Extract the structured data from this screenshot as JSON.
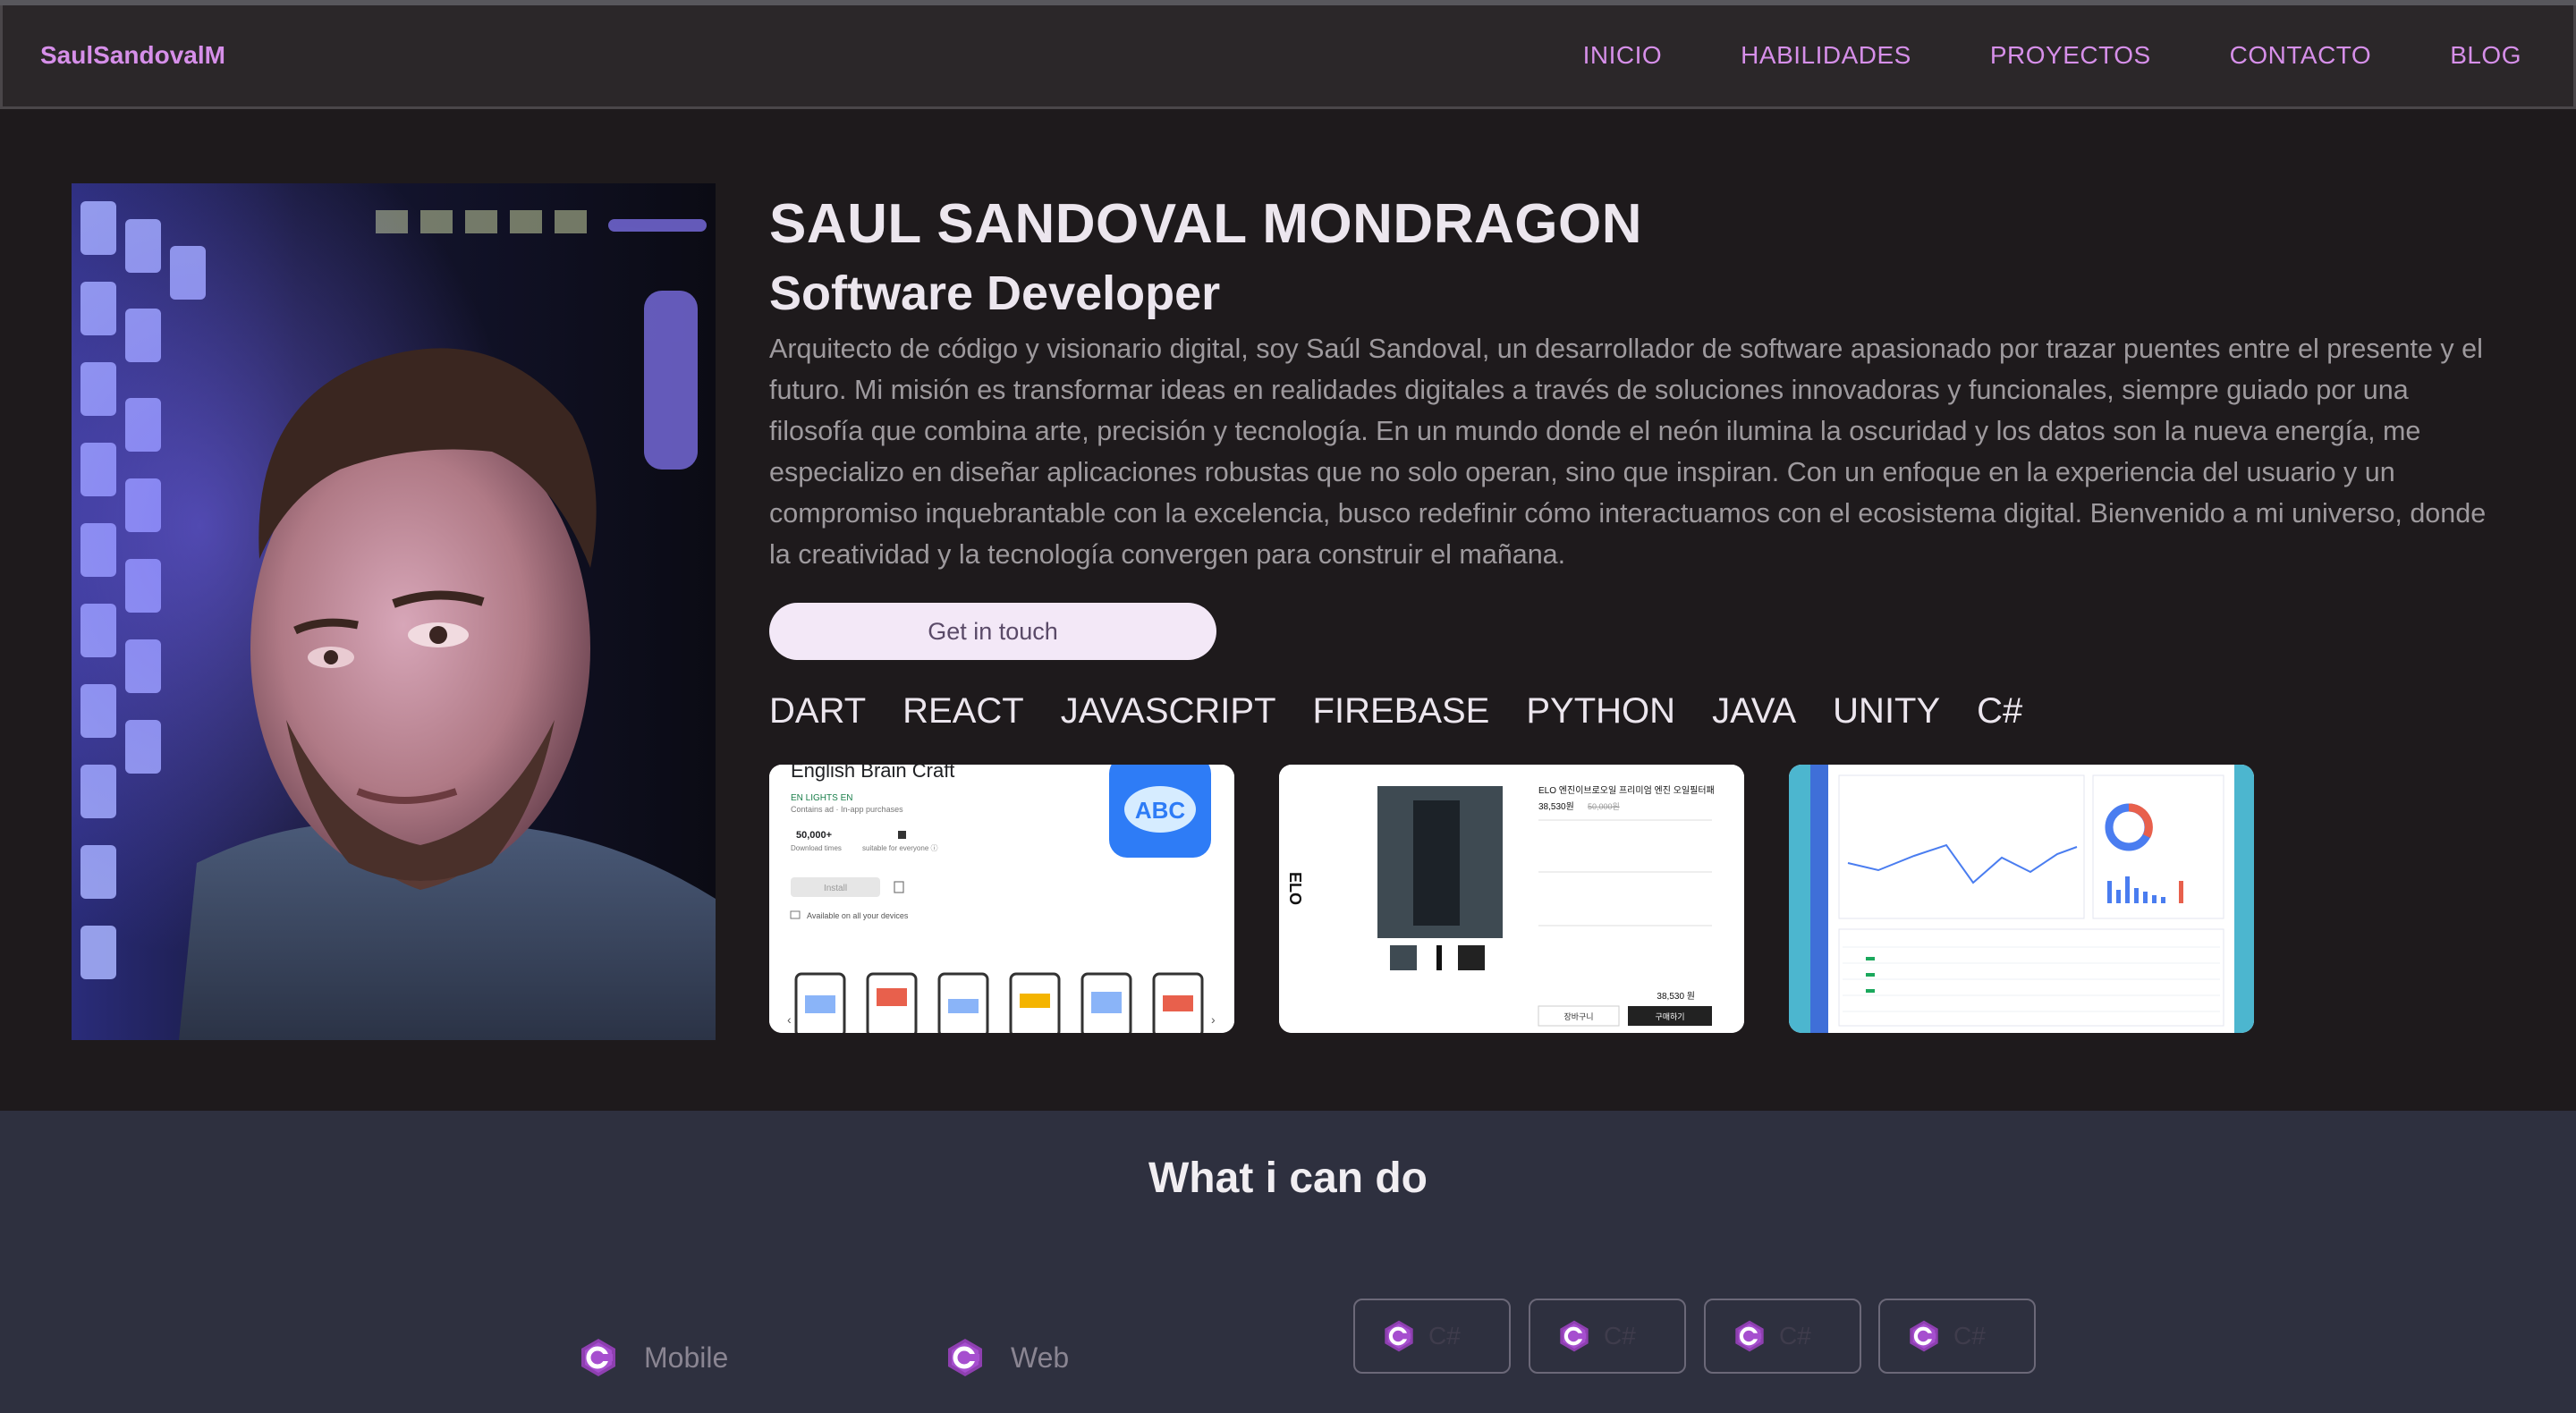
{
  "nav": {
    "brand": "SaulSandovalM",
    "links": [
      "INICIO",
      "HABILIDADES",
      "PROYECTOS",
      "CONTACTO",
      "BLOG"
    ]
  },
  "hero": {
    "name": "SAUL SANDOVAL MONDRAGON",
    "role": "Software Developer",
    "bio": "Arquitecto de código y visionario digital, soy Saúl Sandoval, un desarrollador de software apasionado por trazar puentes entre el presente y el futuro. Mi misión es transformar ideas en realidades digitales a través de soluciones innovadoras y funcionales, siempre guiado por una filosofía que combina arte, precisión y tecnología. En un mundo donde el neón ilumina la oscuridad y los datos son la nueva energía, me especializo en diseñar aplicaciones robustas que no solo operan, sino que inspiran. Con un enfoque en la experiencia del usuario y un compromiso inquebrantable con la excelencia, busco redefinir cómo interactuamos con el ecosistema digital. Bienvenido a mi universo, donde la creatividad y la tecnología convergen para construir el mañana.",
    "cta_label": "Get in touch",
    "skills": [
      "DART",
      "REACT",
      "JAVASCRIPT",
      "FIREBASE",
      "PYTHON",
      "JAVA",
      "UNITY",
      "C#"
    ]
  },
  "projects": [
    {
      "title": "English Brain Craft",
      "publisher": "EN LIGHTS EN",
      "note": "Contains ad · In-app purchases",
      "downloads": "50,000+",
      "downloads_label": "Download times",
      "rating_label": "suitable for everyone ⓘ",
      "install_label": "Install",
      "devices_label": "Available on all your devices",
      "logo_text": "ABC"
    },
    {
      "brand": "ELO",
      "product_title": "ELO 엔진이브로오일 프리미엄 엔진 오일필터패",
      "price": "38,530원",
      "old_price": "50,000원",
      "total": "38,530 원",
      "btn_left": "장바구니",
      "btn_right": "구매하기"
    },
    {
      "kind": "dashboard"
    }
  ],
  "what": {
    "title": "What i can do",
    "categories": [
      "Mobile",
      "Web"
    ],
    "chips": [
      "C#",
      "C#",
      "C#",
      "C#"
    ]
  },
  "colors": {
    "accent": "#d68fe9",
    "nav_bg": "#2b2729",
    "hero_bg": "#1e1a1c",
    "section_bg": "#2e303f",
    "cta_bg": "#f3e8f7"
  },
  "icons": {
    "category_icon": "csharp-icon",
    "chip_icon": "csharp-icon"
  }
}
